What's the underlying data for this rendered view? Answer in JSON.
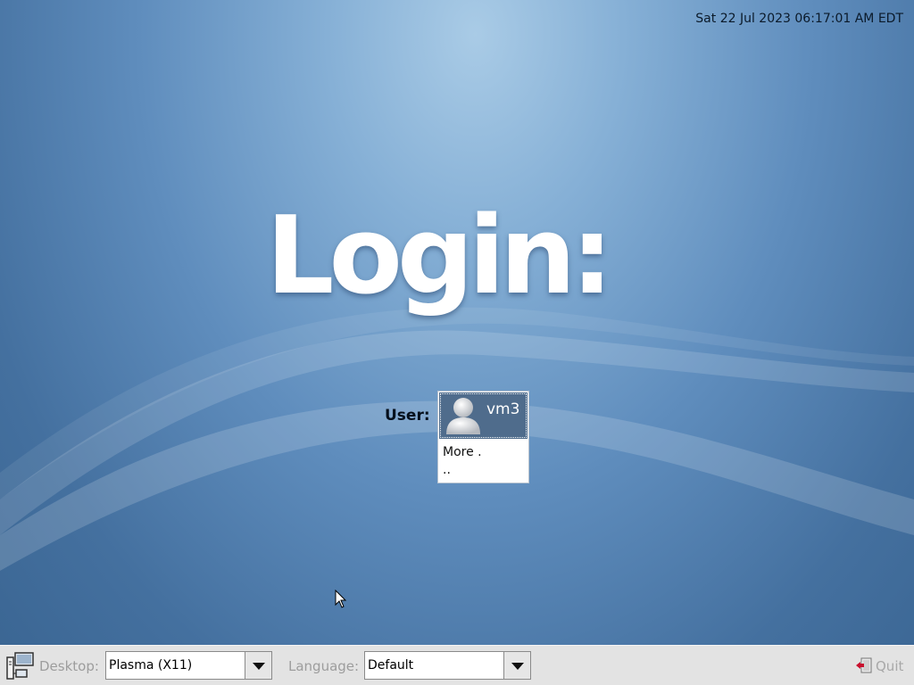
{
  "clock": {
    "text": "Sat 22 Jul 2023 06:17:01 AM EDT"
  },
  "greeting": {
    "title": "Login:"
  },
  "user_select": {
    "label": "User:",
    "users": [
      {
        "name": "vm3",
        "icon": "user-avatar-icon",
        "selected": true
      }
    ],
    "more_label": "More .\n.."
  },
  "bottom_bar": {
    "desktop": {
      "label": "Desktop:",
      "value": "Plasma (X11)",
      "icon": "desktop-session-icon"
    },
    "language": {
      "label": "Language:",
      "value": "Default"
    },
    "quit": {
      "label": "Quit",
      "icon": "quit-door-icon"
    }
  },
  "colors": {
    "background_center": "#a9cbe6",
    "background_edge": "#3a6592",
    "selection": "#4f6c8c",
    "bottom_bar": "#e3e3e3",
    "disabled_text": "#9d9d9d"
  }
}
